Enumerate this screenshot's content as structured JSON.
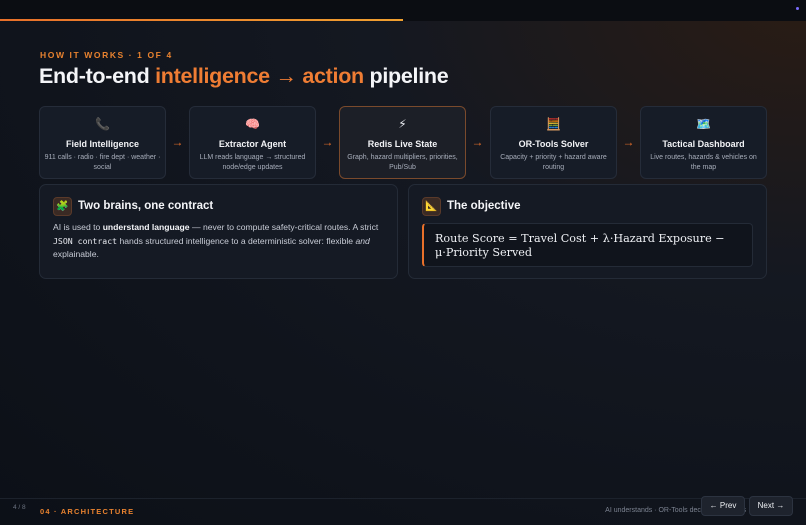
{
  "header": {
    "kicker": "HOW IT WORKS · 1 OF 4",
    "title_part1": "End-to-end ",
    "title_hl1": "intelligence",
    "title_arrow": " → ",
    "title_hl2": "action",
    "title_part2": " pipeline"
  },
  "pipeline": [
    {
      "icon": "📞",
      "name": "Field Intelligence",
      "desc": "911 calls · radio · fire dept · weather · social"
    },
    {
      "icon": "🧠",
      "name": "Extractor Agent",
      "desc": "LLM reads language → structured node/edge updates"
    },
    {
      "icon": "⚡",
      "name": "Redis Live State",
      "desc": "Graph, hazard multipliers, priorities, Pub/Sub"
    },
    {
      "icon": "🧮",
      "name": "OR-Tools Solver",
      "desc": "Capacity + priority + hazard aware routing"
    },
    {
      "icon": "🗺️",
      "name": "Tactical Dashboard",
      "desc": "Live routes, hazards & vehicles on the map"
    }
  ],
  "arrow_glyph": "→",
  "card_brains": {
    "icon": "🧩",
    "title": "Two brains, one contract",
    "t1": "AI is used to ",
    "b1": "understand language",
    "t2": " — never to compute safety-critical routes. A strict ",
    "code": "JSON contract",
    "t3": " hands structured intelligence to a deterministic solver: flexible ",
    "em": "and",
    "t4": " explainable."
  },
  "card_objective": {
    "icon": "📐",
    "title": "The objective",
    "formula": "Route Score = Travel Cost + λ·Hazard Exposure − μ·Priority Served"
  },
  "footer": {
    "page": "4 / 8",
    "section": "04 · ARCHITECTURE",
    "tagline": "AI understands · OR-Tools decides · Humans",
    "prev": "← Prev",
    "next": "Next →"
  },
  "progress_fraction": 0.5,
  "colors": {
    "accent": "#ef7d34",
    "background": "#0f131b"
  }
}
